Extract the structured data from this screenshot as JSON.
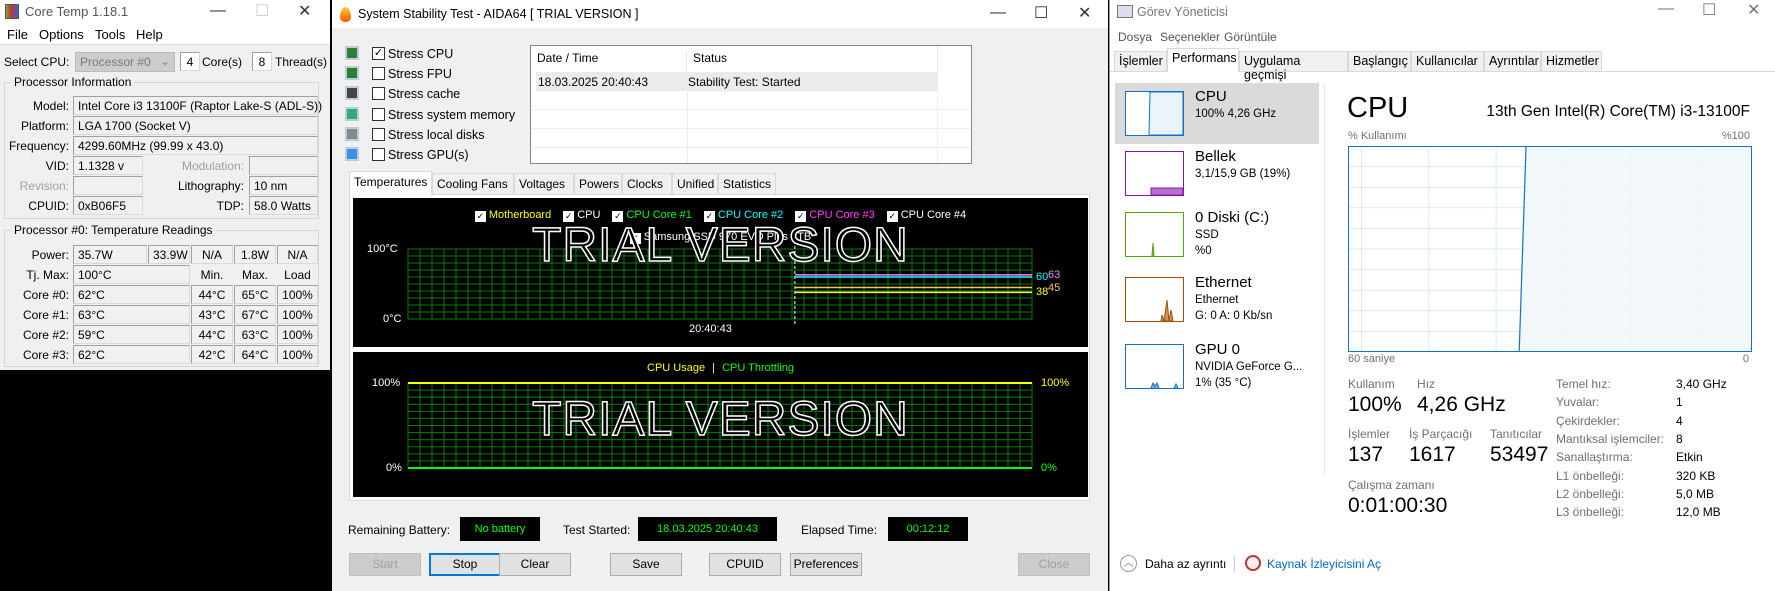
{
  "coretemp": {
    "title": "Core Temp 1.18.1",
    "menu": [
      "File",
      "Options",
      "Tools",
      "Help"
    ],
    "select_cpu_label": "Select CPU:",
    "processor_select": "Processor #0",
    "cores": "4",
    "cores_label": "Core(s)",
    "threads": "8",
    "threads_label": "Thread(s)",
    "info_group": "Processor Information",
    "model_label": "Model:",
    "model": "Intel Core i3 13100F (Raptor Lake-S (ADL-S))",
    "platform_label": "Platform:",
    "platform": "LGA 1700 (Socket V)",
    "frequency_label": "Frequency:",
    "frequency": "4299.60MHz (99.99 x 43.0)",
    "vid_label": "VID:",
    "vid": "1.1328 v",
    "modulation_label": "Modulation:",
    "revision_label": "Revision:",
    "lithography_label": "Lithography:",
    "lithography": "10 nm",
    "cpuid_label": "CPUID:",
    "cpuid": "0xB06F5",
    "tdp_label": "TDP:",
    "tdp": "58.0 Watts",
    "temp_group": "Processor #0: Temperature Readings",
    "power_label": "Power:",
    "power": [
      "35.7W",
      "33.9W",
      "N/A",
      "1.8W",
      "N/A"
    ],
    "tjmax_label": "Tj. Max:",
    "tjmax": "100°C",
    "col_headers": [
      "Min.",
      "Max.",
      "Load"
    ],
    "cores_rows": [
      {
        "label": "Core #0:",
        "temp": "62°C",
        "min": "44°C",
        "max": "65°C",
        "load": "100%"
      },
      {
        "label": "Core #1:",
        "temp": "63°C",
        "min": "43°C",
        "max": "67°C",
        "load": "100%"
      },
      {
        "label": "Core #2:",
        "temp": "59°C",
        "min": "44°C",
        "max": "63°C",
        "load": "100%"
      },
      {
        "label": "Core #3:",
        "temp": "62°C",
        "min": "42°C",
        "max": "64°C",
        "load": "100%"
      }
    ]
  },
  "aida": {
    "title": "System Stability Test - AIDA64  [ TRIAL VERSION ]",
    "stress": [
      {
        "label": "Stress CPU",
        "checked": true,
        "icon": "cpu-chip-icon"
      },
      {
        "label": "Stress FPU",
        "checked": false,
        "icon": "fpu-chip-icon"
      },
      {
        "label": "Stress cache",
        "checked": false,
        "icon": "cache-chip-icon"
      },
      {
        "label": "Stress system memory",
        "checked": false,
        "icon": "memory-module-icon"
      },
      {
        "label": "Stress local disks",
        "checked": false,
        "icon": "disk-drive-icon"
      },
      {
        "label": "Stress GPU(s)",
        "checked": false,
        "icon": "monitor-gpu-icon"
      }
    ],
    "log_headers": [
      "Date / Time",
      "Status"
    ],
    "log_rows": [
      {
        "time": "18.03.2025 20:40:43",
        "status": "Stability Test: Started"
      }
    ],
    "tabs": [
      "Temperatures",
      "Cooling Fans",
      "Voltages",
      "Powers",
      "Clocks",
      "Unified",
      "Statistics"
    ],
    "active_tab": "Temperatures",
    "temp_chart": {
      "legend": [
        {
          "label": "Motherboard",
          "color": "#ffff00"
        },
        {
          "label": "CPU",
          "color": "#ffffff"
        },
        {
          "label": "CPU Core #1",
          "color": "#00ff00"
        },
        {
          "label": "CPU Core #2",
          "color": "#00ffff"
        },
        {
          "label": "CPU Core #3",
          "color": "#ff40ff"
        },
        {
          "label": "CPU Core #4",
          "color": "#ffffff"
        },
        {
          "label": "Samsung SSD 970 EVO Plus 1TB",
          "color": "#ffffff"
        }
      ],
      "y_max": "100°C",
      "y_min": "0°C",
      "time_label": "20:40:43",
      "watermark": "TRIAL VERSION",
      "current": [
        {
          "value": 63,
          "color": "#ff80ff",
          "label": "63"
        },
        {
          "value": 60,
          "color": "#00ffff",
          "label": "60"
        },
        {
          "value": 45,
          "color": "#ffc060",
          "label": "45"
        },
        {
          "value": 38,
          "color": "#ffff00",
          "label": "38"
        }
      ]
    },
    "cpu_chart": {
      "title_usage": "CPU Usage",
      "sep": "|",
      "title_throttling": "CPU Throttling",
      "usage_color": "#ffff00",
      "throttle_color": "#00ff00",
      "y_max": "100%",
      "y_min": "0%",
      "y_max_right": "100%",
      "y_min_right": "0%",
      "usage": 100,
      "throttling": 0,
      "watermark": "TRIAL VERSION"
    },
    "battery_label": "Remaining Battery:",
    "battery": "No battery",
    "started_label": "Test Started:",
    "started": "18.03.2025 20:40:43",
    "elapsed_label": "Elapsed Time:",
    "elapsed": "00:12:12",
    "buttons": {
      "start": "Start",
      "stop": "Stop",
      "clear": "Clear",
      "save": "Save",
      "cpuid": "CPUID",
      "preferences": "Preferences",
      "close": "Close"
    }
  },
  "taskmgr": {
    "title": "Görev Yöneticisi",
    "menu": [
      "Dosya",
      "Seçenekler",
      "Görüntüle"
    ],
    "tabs": [
      "İşlemler",
      "Performans",
      "Uygulama geçmişi",
      "Başlangıç",
      "Kullanıcılar",
      "Ayrıntılar",
      "Hizmetler"
    ],
    "active_tab": "Performans",
    "sidebar": [
      {
        "name": "CPU",
        "line1": "100% 4,26 GHz",
        "line2": "",
        "color": "#1171c9"
      },
      {
        "name": "Bellek",
        "line1": "3,1/15,9 GB (19%)",
        "line2": "",
        "color": "#8b12ae"
      },
      {
        "name": "0 Diski (C:)",
        "line1": "SSD",
        "line2": "%0",
        "color": "#4da60c"
      },
      {
        "name": "Ethernet",
        "line1": "Ethernet",
        "line2": "G: 0 A: 0 Kb/sn",
        "color": "#a74f01"
      },
      {
        "name": "GPU 0",
        "line1": "NVIDIA GeForce G...",
        "line2": "1% (35 °C)",
        "color": "#1171c9"
      }
    ],
    "heading": "CPU",
    "model": "13th Gen Intel(R) Core(TM) i3-13100F",
    "graph_label": "% Kullanımı",
    "graph_max": "%100",
    "graph_left": "60 saniye",
    "graph_right": "0",
    "graph_color": "#1171c9",
    "graph_fill": "#f1f6fa",
    "usage_history": [
      0,
      0,
      0,
      0,
      0,
      0,
      0,
      0,
      0,
      0,
      0,
      0,
      0,
      0,
      0,
      0,
      0,
      0,
      0,
      0,
      0,
      0,
      0,
      0,
      0,
      0,
      100,
      100,
      100,
      100,
      100,
      100,
      100,
      100,
      100,
      100,
      100,
      100,
      100,
      100,
      100,
      100,
      100,
      100,
      100,
      100,
      100,
      100,
      100,
      100,
      100,
      100,
      100,
      100,
      100,
      100,
      100,
      100,
      100,
      100
    ],
    "usage_label": "Kullanım",
    "usage": "100%",
    "speed_label": "Hız",
    "speed": "4,26 GHz",
    "processes_label": "İşlemler",
    "processes": "137",
    "threads_label": "İş Parçacığı",
    "threads": "1617",
    "handles_label": "Tanıtıcılar",
    "handles": "53497",
    "uptime_label": "Çalışma zamanı",
    "uptime": "0:01:00:30",
    "specs": [
      {
        "label": "Temel hız:",
        "value": "3,40 GHz"
      },
      {
        "label": "Yuvalar:",
        "value": "1"
      },
      {
        "label": "Çekirdekler:",
        "value": "4"
      },
      {
        "label": "Mantıksal işlemciler:",
        "value": "8"
      },
      {
        "label": "Sanallaştırma:",
        "value": "Etkin"
      },
      {
        "label": "L1 önbelleği:",
        "value": "320 KB"
      },
      {
        "label": "L2 önbelleği:",
        "value": "5,0 MB"
      },
      {
        "label": "L3 önbelleği:",
        "value": "12,0 MB"
      }
    ],
    "fewer_details": "Daha az ayrıntı",
    "resource_monitor": "Kaynak İzleyicisini Aç"
  }
}
